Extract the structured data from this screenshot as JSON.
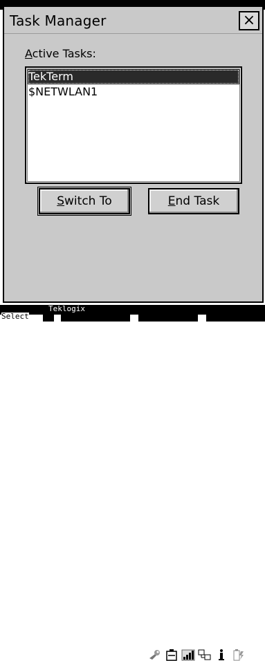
{
  "background_app": {
    "top_strip_text": ""
  },
  "dialog": {
    "title": "Task Manager",
    "close_label": "×",
    "active_tasks_label_prefix": "A",
    "active_tasks_label_rest": "ctive Tasks:",
    "tasks": [
      "TekTerm",
      "$NETWLAN1"
    ],
    "selected_index": 0,
    "switch_button": {
      "accel": "S",
      "rest": "witch To"
    },
    "end_button": {
      "accel": "E",
      "rest": "nd Task"
    }
  },
  "taskbar": {
    "brand_text": "Teklogix",
    "softkey_left_label": "Select",
    "tray_icons": [
      "wrench-icon",
      "battery-icon",
      "signal-icon",
      "network-icon",
      "info-icon",
      "power-icon"
    ]
  }
}
